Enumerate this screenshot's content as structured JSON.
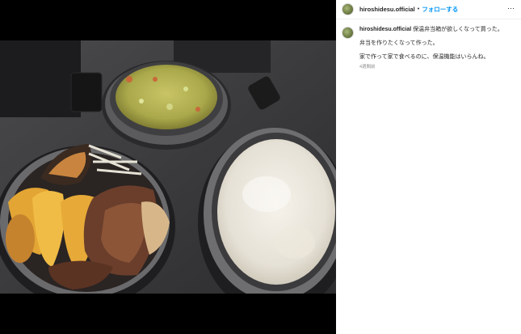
{
  "post": {
    "username": "hiroshidesu.official",
    "follow_label": "フォローする",
    "more_icon": "more-horizontal-icon",
    "separator": "•"
  },
  "caption": {
    "username": "hiroshidesu.official",
    "line1": "保温弁当箱が欲しくなって買った。",
    "line2": "弁当を作りたくなって作った。",
    "line3": "家で作って家で食べるのに、保温機能はいらんね。",
    "time": "4週間前"
  },
  "colors": {
    "follow": "#0095f6",
    "text": "#262626",
    "muted": "#8e8e8e"
  }
}
